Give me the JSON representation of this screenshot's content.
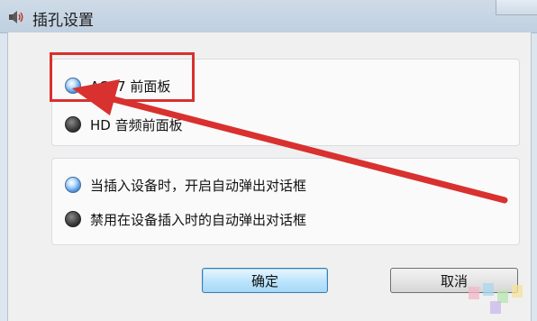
{
  "window": {
    "title": "插孔设置",
    "icon": "speaker-icon"
  },
  "front_panel_group": {
    "options": [
      {
        "label": "AC97 前面板",
        "selected": true
      },
      {
        "label": "HD 音频前面板",
        "selected": false
      }
    ]
  },
  "popup_group": {
    "options": [
      {
        "label": "当插入设备时，开启自动弹出对话框",
        "selected": true
      },
      {
        "label": "禁用在设备插入时的自动弹出对话框",
        "selected": false
      }
    ]
  },
  "buttons": {
    "ok_label": "确定",
    "cancel_label": "取消"
  },
  "colors": {
    "highlight": "#d8312f",
    "accent": "#3c7fb1",
    "title_bar": "#c7d6e4"
  },
  "annotation": {
    "shape": "highlight-box-with-arrow",
    "points_to": "AC97 前面板"
  }
}
